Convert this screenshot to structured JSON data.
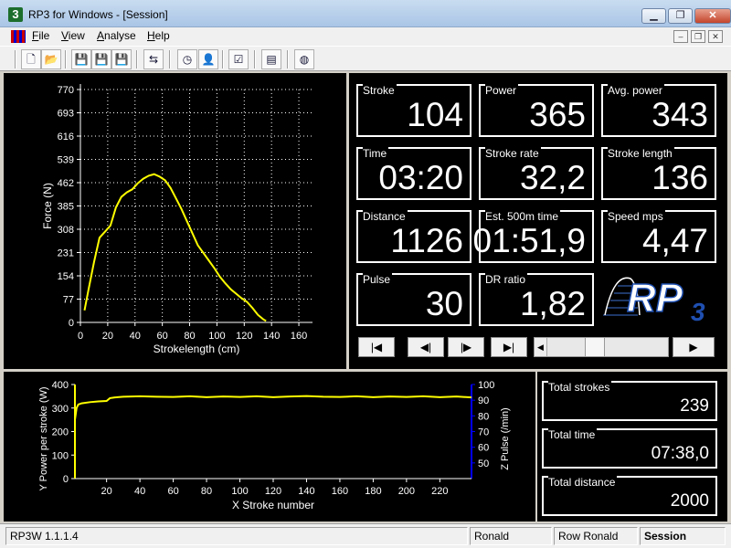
{
  "window": {
    "app_icon": "3",
    "title": "RP3 for Windows - [Session]",
    "minimize": "▁",
    "maximize": "❐",
    "close": "✕"
  },
  "menu": {
    "items": [
      "File",
      "View",
      "Analyse",
      "Help"
    ],
    "mdi": [
      "–",
      "❐",
      "✕"
    ]
  },
  "toolbar": {
    "icons": [
      "new-file-icon",
      "open-folder-icon",
      "save-icon",
      "save-as-icon",
      "save-all-icon",
      "export-icon",
      "timer-icon",
      "user-icon",
      "checklist-icon",
      "chart-icon",
      "globe-icon"
    ],
    "glyphs": [
      "🗋",
      "📂",
      "💾",
      "💾",
      "💾",
      "⇆",
      "◷",
      "👤",
      "☑",
      "▤",
      "◍"
    ]
  },
  "metrics": [
    {
      "label": "Stroke",
      "value": "104"
    },
    {
      "label": "Power",
      "value": "365"
    },
    {
      "label": "Avg. power",
      "value": "343"
    },
    {
      "label": "Time",
      "value": "03:20"
    },
    {
      "label": "Stroke rate",
      "value": "32,2"
    },
    {
      "label": "Stroke length",
      "value": "136"
    },
    {
      "label": "Distance",
      "value": "1126"
    },
    {
      "label": "Est. 500m time",
      "value": "01:51,9"
    },
    {
      "label": "Speed mps",
      "value": "4,47"
    },
    {
      "label": "Pulse",
      "value": "30"
    },
    {
      "label": "DR ratio",
      "value": "1,82"
    }
  ],
  "logo": {
    "text": "RP",
    "sub": "3"
  },
  "navigation": {
    "first": "|◀",
    "prev": "◀|",
    "next": "|▶",
    "last": "▶|",
    "play": "▶",
    "scroll_left": "◀",
    "position": 0.37
  },
  "totals": [
    {
      "label": "Total strokes",
      "value": "239"
    },
    {
      "label": "Total time",
      "value": "07:38,0"
    },
    {
      "label": "Total distance",
      "value": "2000"
    }
  ],
  "colors": {
    "accent": "#ffff00",
    "pulse_axis": "#0000ff",
    "logo_blue": "#1f4fb0"
  },
  "chart_data": [
    {
      "type": "line",
      "xlabel": "Strokelength (cm)",
      "ylabel": "Force (N)",
      "xlim": [
        0,
        170
      ],
      "ylim": [
        0,
        770
      ],
      "x_ticks": [
        0,
        20,
        40,
        60,
        80,
        100,
        120,
        140,
        160
      ],
      "y_ticks": [
        0,
        77,
        154,
        231,
        308,
        385,
        462,
        539,
        616,
        693,
        770
      ],
      "grid": true,
      "series": [
        {
          "x": [
            3,
            6,
            10,
            14,
            18,
            22,
            26,
            30,
            34,
            38,
            42,
            46,
            50,
            54,
            58,
            62,
            66,
            70,
            74,
            78,
            82,
            86,
            90,
            94,
            98,
            102,
            106,
            110,
            114,
            118,
            122,
            126,
            130,
            134,
            136
          ],
          "values": [
            40,
            110,
            200,
            280,
            300,
            320,
            380,
            415,
            430,
            440,
            460,
            475,
            485,
            490,
            482,
            470,
            445,
            410,
            375,
            335,
            295,
            255,
            230,
            205,
            180,
            152,
            130,
            110,
            95,
            80,
            68,
            48,
            25,
            10,
            5
          ]
        }
      ]
    },
    {
      "type": "line",
      "xlabel": "X  Stroke number",
      "ylabel": "Y  Power per stroke (W)",
      "ylabel2": "Z  Pulse (/min)",
      "xlim": [
        1,
        239
      ],
      "ylim": [
        0,
        400
      ],
      "ylim2": [
        40,
        100
      ],
      "x_ticks": [
        20,
        40,
        60,
        80,
        100,
        120,
        140,
        160,
        180,
        200,
        220
      ],
      "y_ticks": [
        0,
        100,
        200,
        300,
        400
      ],
      "y2_ticks": [
        50,
        60,
        70,
        80,
        90,
        100
      ],
      "grid": false,
      "series": [
        {
          "x": [
            1,
            2,
            3,
            5,
            10,
            15,
            20,
            22,
            25,
            30,
            40,
            50,
            60,
            70,
            80,
            90,
            100,
            110,
            120,
            130,
            140,
            150,
            160,
            170,
            180,
            190,
            200,
            210,
            220,
            230,
            239
          ],
          "values": [
            250,
            300,
            315,
            320,
            325,
            328,
            330,
            342,
            345,
            348,
            350,
            348,
            347,
            350,
            346,
            349,
            347,
            350,
            346,
            349,
            351,
            348,
            347,
            350,
            346,
            349,
            347,
            350,
            346,
            349,
            345
          ]
        }
      ]
    }
  ]
}
